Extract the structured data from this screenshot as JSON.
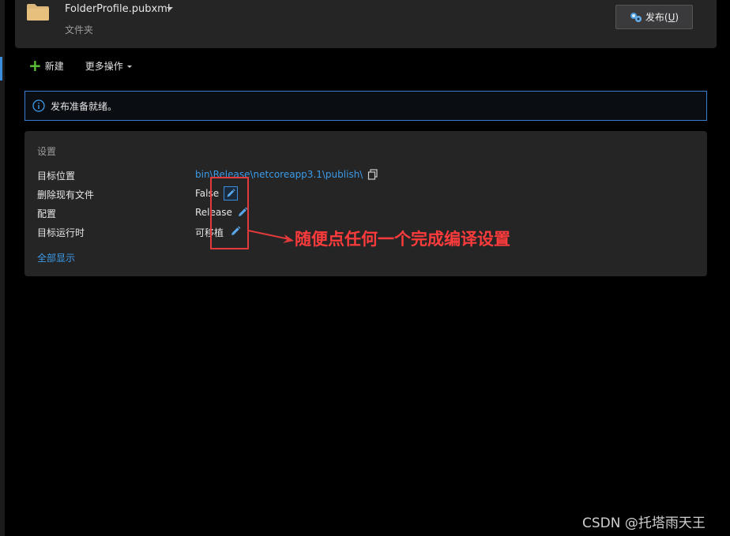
{
  "header": {
    "profile_name": "FolderProfile.pubxml",
    "profile_type": "文件夹",
    "publish_label": "发布(",
    "publish_hotkey": "U",
    "publish_suffix": ")"
  },
  "toolbar": {
    "new_label": "新建",
    "more_label": "更多操作"
  },
  "info": {
    "message": "发布准备就绪。"
  },
  "settings": {
    "title": "设置",
    "rows": [
      {
        "label": "目标位置",
        "value": "bin\\Release\\netcoreapp3.1\\publish\\"
      },
      {
        "label": "删除现有文件",
        "value": "False"
      },
      {
        "label": "配置",
        "value": "Release"
      },
      {
        "label": "目标运行时",
        "value": "可移植"
      }
    ],
    "show_all": "全部显示"
  },
  "annotation": {
    "text": "随便点任何一个完成编译设置",
    "color": "#e23a3a"
  },
  "watermark": "CSDN @托塔雨天王",
  "colors": {
    "accent": "#3b8de0",
    "link": "#3b9be8",
    "panel": "#252526",
    "background": "#000000"
  },
  "icons": [
    "folder-icon",
    "publish-icon",
    "plus-icon",
    "info-icon",
    "copy-icon",
    "pencil-icon"
  ]
}
